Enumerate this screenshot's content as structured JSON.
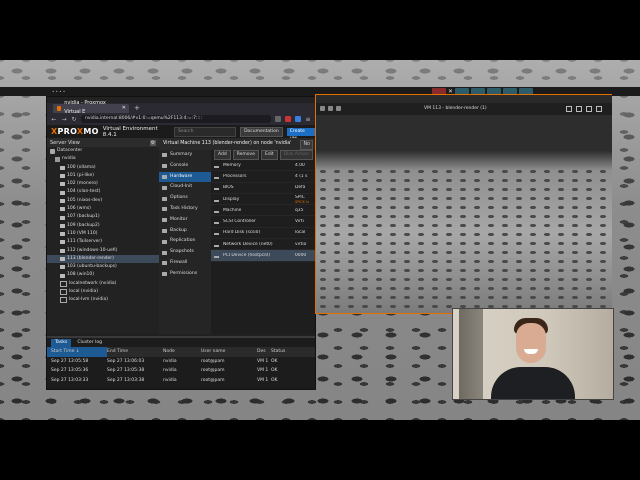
{
  "browser": {
    "tab_title": "nvidia - Proxmox Virtual E",
    "url": "nvidia.internal:8006/#v1:0:=qemu%2F113:4:=:7::::",
    "pve": {
      "logo_left": "PRO",
      "logo_x": "X",
      "logo_mid": "MO",
      "logo_x2": "X",
      "version": "Virtual Environment 8.4.1",
      "search_placeholder": "Search",
      "documentation": "Documentation",
      "create_vm": "Create VM",
      "server_view": "Server View",
      "tree": [
        {
          "label": "Datacenter",
          "type": "dc",
          "indent": 1
        },
        {
          "label": "nvidia",
          "type": "node",
          "indent": 2
        },
        {
          "label": "100 (ollama)",
          "type": "vm",
          "indent": 3
        },
        {
          "label": "101 (pi-like)",
          "type": "vm",
          "indent": 3
        },
        {
          "label": "102 (monero)",
          "type": "vm",
          "indent": 3
        },
        {
          "label": "104 (vlan-test)",
          "type": "vm",
          "indent": 3
        },
        {
          "label": "105 (nixos-dev)",
          "type": "vm",
          "indent": 3
        },
        {
          "label": "106 (wms)",
          "type": "vm",
          "indent": 3
        },
        {
          "label": "107 (backup1)",
          "type": "vm",
          "indent": 3
        },
        {
          "label": "109 (backup2)",
          "type": "vm",
          "indent": 3
        },
        {
          "label": "110 (VM 110)",
          "type": "vm",
          "indent": 3
        },
        {
          "label": "111 (Tailserver)",
          "type": "vm",
          "indent": 3
        },
        {
          "label": "112 (windows-10-uefi)",
          "type": "vm",
          "indent": 3
        },
        {
          "label": "113 (blender-render)",
          "type": "vm",
          "indent": 3,
          "selected": true
        },
        {
          "label": "103 (ubuntu-backups)",
          "type": "vm",
          "indent": 3
        },
        {
          "label": "108 (win10)",
          "type": "vm",
          "indent": 3
        },
        {
          "label": "localnetwork (nvidia)",
          "type": "storage",
          "indent": 3
        },
        {
          "label": "local (nvidia)",
          "type": "storage",
          "indent": 3
        },
        {
          "label": "local-lvm (nvidia)",
          "type": "storage",
          "indent": 3
        }
      ],
      "content_title": "Virtual Machine 113 (blender-render) on node 'nvidia'",
      "help_label": "No",
      "menu": [
        {
          "label": "Summary"
        },
        {
          "label": "Console"
        },
        {
          "label": "Hardware",
          "selected": true
        },
        {
          "label": "Cloud-Init"
        },
        {
          "label": "Options"
        },
        {
          "label": "Task History"
        },
        {
          "label": "Monitor"
        },
        {
          "label": "Backup"
        },
        {
          "label": "Replication"
        },
        {
          "label": "Snapshots"
        },
        {
          "label": "Firewall"
        },
        {
          "label": "Permissions"
        }
      ],
      "hw_toolbar": {
        "add": "Add",
        "remove": "Remove",
        "edit": "Edit",
        "disk_action": "Disk Action"
      },
      "hardware": [
        {
          "key": "Memory",
          "value": "4.00"
        },
        {
          "key": "Processors",
          "value": "4 (1 s"
        },
        {
          "key": "BIOS",
          "value": "Defa"
        },
        {
          "key": "Display",
          "value": "SPIC",
          "extra": "SPICE is"
        },
        {
          "key": "Machine",
          "value": "q35"
        },
        {
          "key": "SCSI Controller",
          "value": "Virti"
        },
        {
          "key": "Hard Disk (scsi0)",
          "value": "local"
        },
        {
          "key": "Network Device (net0)",
          "value": "virtio"
        },
        {
          "key": "PCI Device (hostpci0)",
          "value": "0000",
          "selected": true
        }
      ],
      "tasks_tabs": [
        "Tasks",
        "Cluster log"
      ],
      "tasks_columns": [
        "Start Time ↓",
        "End Time",
        "Node",
        "User name",
        "Des",
        "Status"
      ],
      "tasks": [
        [
          "Sep 27 13:05:58",
          "Sep 27 13:06:03",
          "nvidia",
          "root@pam",
          "VM 1",
          "OK"
        ],
        [
          "Sep 27 13:05:36",
          "Sep 27 13:05:38",
          "nvidia",
          "root@pam",
          "VM 1",
          "OK"
        ],
        [
          "Sep 27 13:03:33",
          "Sep 27 13:03:38",
          "nvidia",
          "root@pam",
          "VM 1",
          "OK"
        ]
      ]
    }
  },
  "viewer": {
    "title": "VM 113 - blender-render (1)"
  },
  "colors": {
    "accent": "#e57000",
    "select": "#1e5a93",
    "panel": "#1e1e1e"
  }
}
